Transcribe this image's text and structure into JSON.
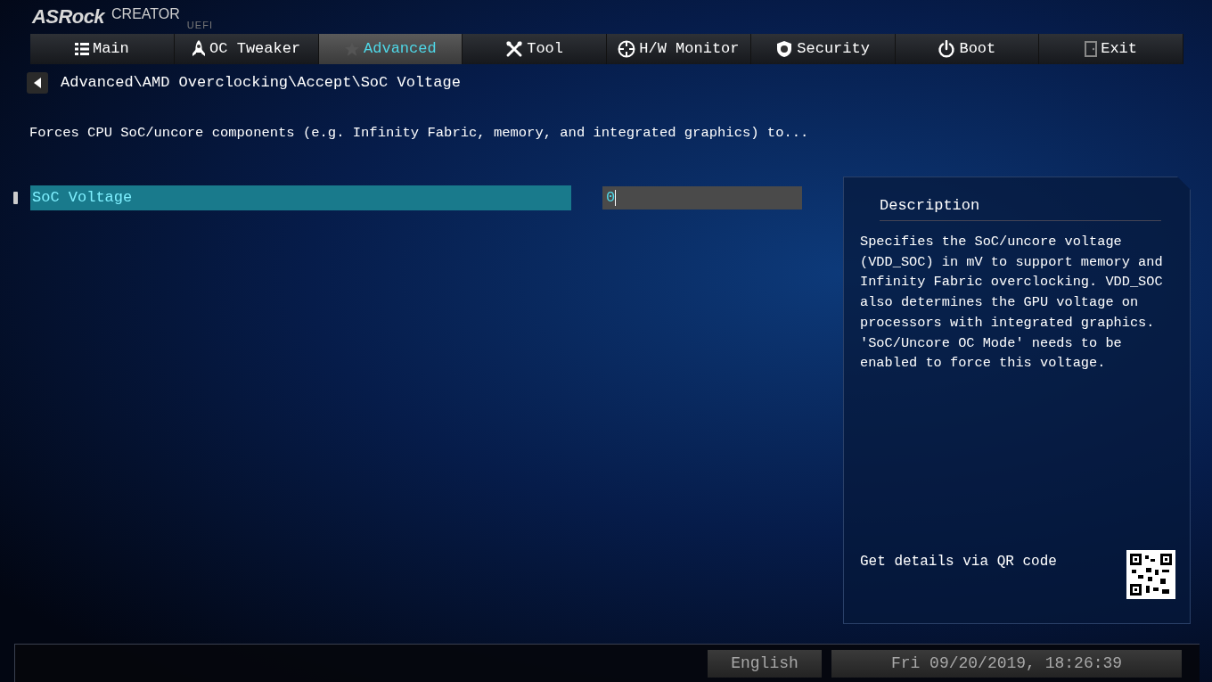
{
  "logo": {
    "brand": "ASRock",
    "product": "CREATOR",
    "sub": "UEFI"
  },
  "tabs": [
    {
      "label": "Main",
      "selected": false
    },
    {
      "label": "OC Tweaker",
      "selected": false
    },
    {
      "label": "Advanced",
      "selected": true
    },
    {
      "label": "Tool",
      "selected": false
    },
    {
      "label": "H/W Monitor",
      "selected": false
    },
    {
      "label": "Security",
      "selected": false
    },
    {
      "label": "Boot",
      "selected": false
    },
    {
      "label": "Exit",
      "selected": false
    }
  ],
  "breadcrumb": "Advanced\\AMD Overclocking\\Accept\\SoC Voltage",
  "help_line": "Forces CPU SoC/uncore components (e.g. Infinity Fabric, memory, and integrated graphics) to...",
  "settings": [
    {
      "label": "SoC Voltage",
      "value": "0",
      "selected": true
    }
  ],
  "description": {
    "title": "Description",
    "text": "Specifies the SoC/uncore voltage (VDD_SOC) in mV to support memory and Infinity Fabric overclocking. VDD_SOC also determines the GPU voltage on processors with integrated graphics. 'SoC/Uncore OC Mode' needs to be enabled to force this voltage.",
    "qr_label": "Get details via QR code"
  },
  "status_bar": {
    "language": "English",
    "datetime": "Fri 09/20/2019, 18:26:39"
  }
}
